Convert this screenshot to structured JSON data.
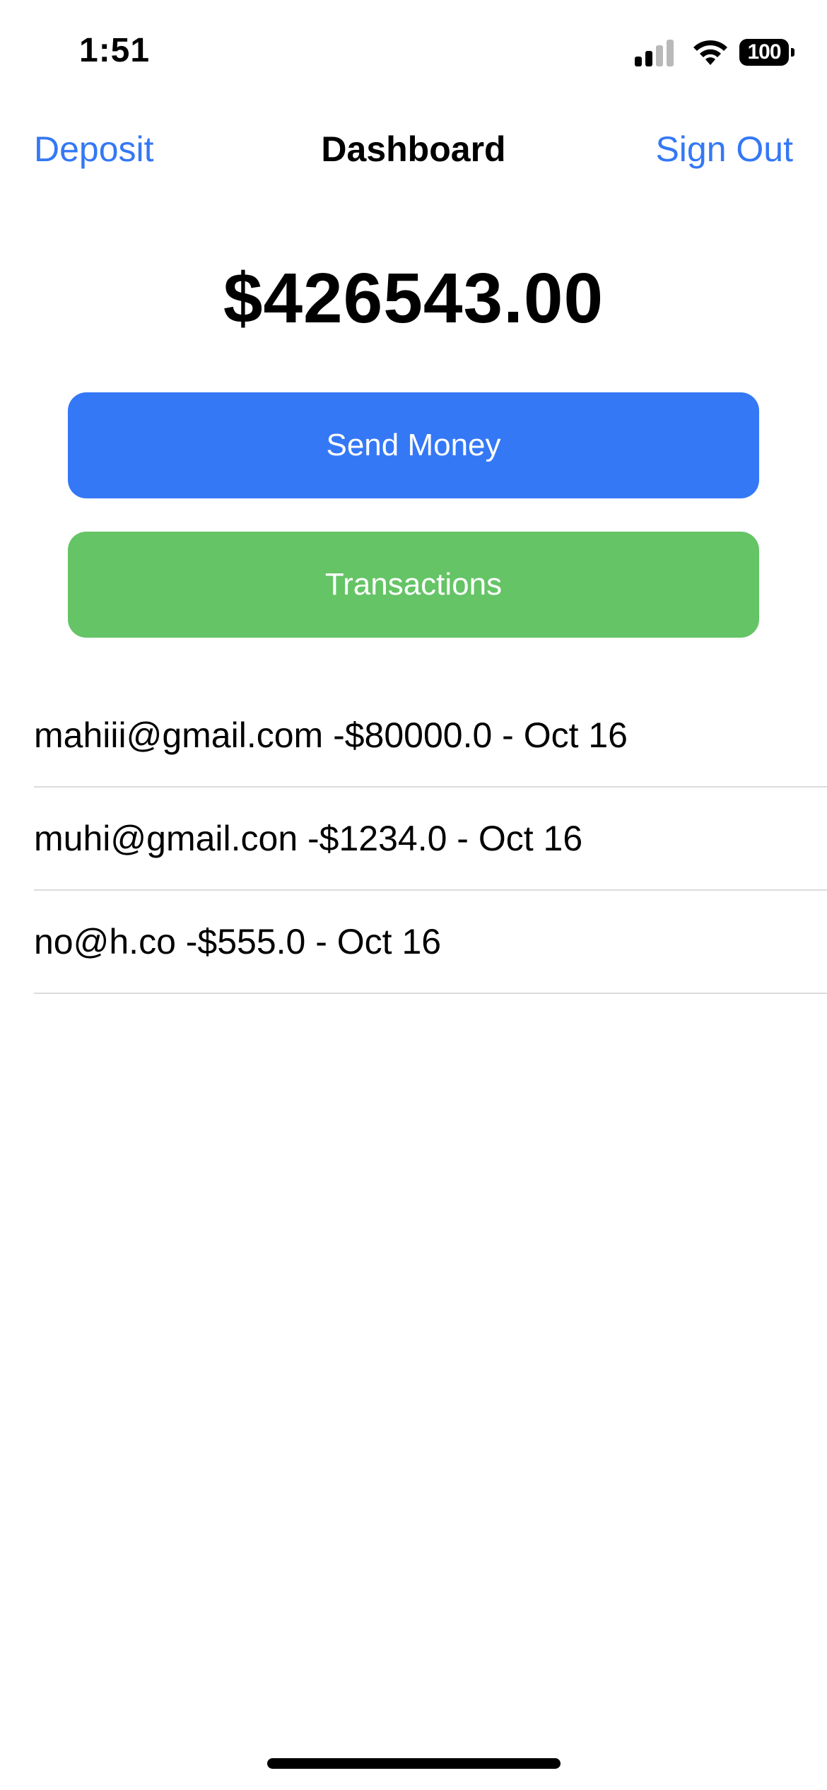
{
  "status_bar": {
    "time": "1:51",
    "battery": "100",
    "icons": [
      "signal-icon",
      "wifi-icon",
      "battery-icon"
    ]
  },
  "nav": {
    "left": "Deposit",
    "title": "Dashboard",
    "right": "Sign Out"
  },
  "balance": "$426543.00",
  "buttons": {
    "send_money": "Send Money",
    "transactions": "Transactions"
  },
  "transactions": [
    "mahiii@gmail.com -$80000.0 - Oct 16",
    "muhi@gmail.con -$1234.0 - Oct 16",
    "no@h.co -$555.0 - Oct 16"
  ],
  "colors": {
    "accent": "#3478f6",
    "send_button": "#3478f6",
    "transactions_button": "#65c466",
    "divider": "#dcdcdc"
  }
}
